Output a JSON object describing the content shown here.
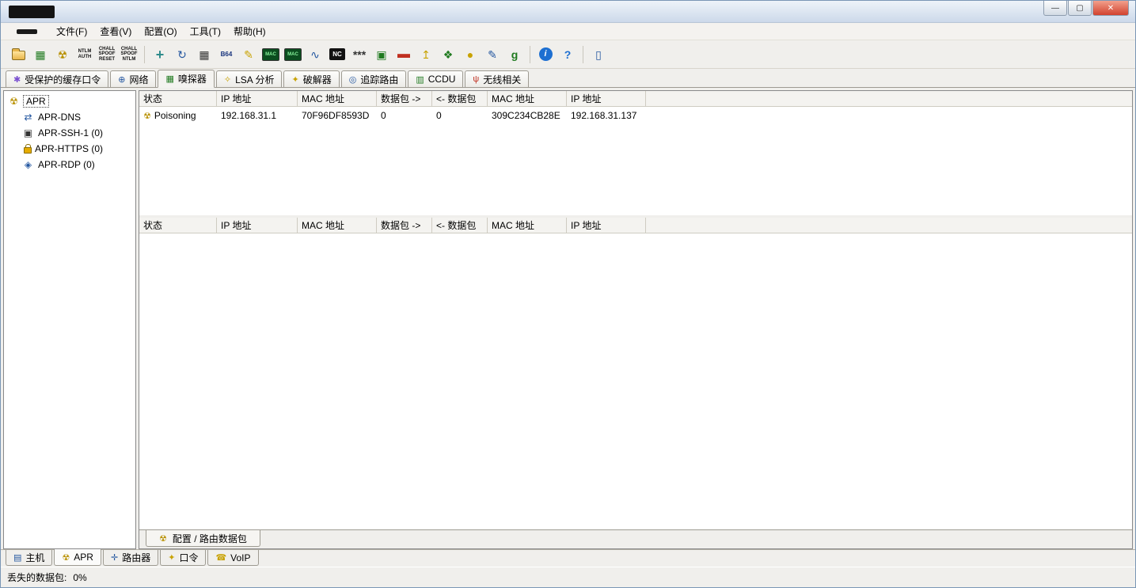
{
  "window": {
    "controls": {
      "minimize": "—",
      "maximize": "▢",
      "close": "✕"
    }
  },
  "menu": {
    "items": [
      {
        "label": "文件(F)"
      },
      {
        "label": "查看(V)"
      },
      {
        "label": "配置(O)"
      },
      {
        "label": "工具(T)"
      },
      {
        "label": "帮助(H)"
      }
    ]
  },
  "toolbar": {
    "icons": [
      {
        "name": "open-file-icon",
        "glyph": ""
      },
      {
        "name": "network-adapter-icon",
        "glyph": "▦"
      },
      {
        "name": "start-stop-apr-icon",
        "glyph": "☢"
      },
      {
        "name": "ntlm-auth-icon",
        "glyph": "NTLM AUTH"
      },
      {
        "name": "chall-spoof-reset-icon",
        "glyph": "CHALL SPOOF RESET"
      },
      {
        "name": "chall-spoof-ntlm-icon",
        "glyph": "CHALL SPOOF NTLM"
      },
      {
        "name": "add-to-list-icon",
        "glyph": "+"
      },
      {
        "name": "restore-icon",
        "glyph": "↻"
      },
      {
        "name": "checkerboard-icon",
        "glyph": "▦"
      },
      {
        "name": "base64-icon",
        "glyph": "B64"
      },
      {
        "name": "notes-icon",
        "glyph": "✎"
      },
      {
        "name": "mac-scanner-icon",
        "glyph": "MAC"
      },
      {
        "name": "mac-monitor-icon",
        "glyph": "MAC"
      },
      {
        "name": "wiretap-icon",
        "glyph": "∿"
      },
      {
        "name": "netcat-icon",
        "glyph": "NC"
      },
      {
        "name": "password-list-icon",
        "glyph": "***"
      },
      {
        "name": "remote-console-icon",
        "glyph": "▣"
      },
      {
        "name": "rdp-screen-icon",
        "glyph": "▬"
      },
      {
        "name": "upload-icon",
        "glyph": "↥"
      },
      {
        "name": "certificates-icon",
        "glyph": "❖"
      },
      {
        "name": "sphere-icon",
        "glyph": "●"
      },
      {
        "name": "edit-page-icon",
        "glyph": "✎"
      },
      {
        "name": "messenger-icon",
        "glyph": "g"
      },
      {
        "name": "info-icon",
        "glyph": "i"
      },
      {
        "name": "help-icon",
        "glyph": "?"
      },
      {
        "name": "exit-icon",
        "glyph": "▯"
      }
    ]
  },
  "tabs_top": {
    "items": [
      {
        "label": "受保护的缓存口令",
        "glyph": "✱"
      },
      {
        "label": "网络",
        "glyph": "⊕"
      },
      {
        "label": "嗅探器",
        "glyph": "▦"
      },
      {
        "label": "LSA 分析",
        "glyph": "✧"
      },
      {
        "label": "破解器",
        "glyph": "✦"
      },
      {
        "label": "追踪路由",
        "glyph": "◎"
      },
      {
        "label": "CCDU",
        "glyph": "▥"
      },
      {
        "label": "无线相关",
        "glyph": "ψ"
      }
    ]
  },
  "tree": {
    "items": [
      {
        "label": "APR",
        "glyph": "☢"
      },
      {
        "label": "APR-DNS",
        "glyph": "⇄"
      },
      {
        "label": "APR-SSH-1 (0)",
        "glyph": "▣"
      },
      {
        "label": "APR-HTTPS (0)",
        "glyph": ""
      },
      {
        "label": "APR-RDP (0)",
        "glyph": "◈"
      }
    ]
  },
  "table": {
    "columns": [
      "状态",
      "IP 地址",
      "MAC 地址",
      "数据包 ->",
      "<- 数据包",
      "MAC 地址",
      "IP 地址"
    ],
    "rows": [
      {
        "icon": "☢",
        "status": "Poisoning",
        "ip_left": "192.168.31.1",
        "mac_left": "70F96DF8593D",
        "packets_to": "0",
        "packets_from": "0",
        "mac_right": "309C234CB28E",
        "ip_right": "192.168.31.137"
      }
    ]
  },
  "lower_table": {
    "columns": [
      "状态",
      "IP 地址",
      "MAC 地址",
      "数据包 ->",
      "<- 数据包",
      "MAC 地址",
      "IP 地址"
    ]
  },
  "content_tab": {
    "label": "配置 / 路由数据包",
    "glyph": "☢"
  },
  "tabs_bottom": {
    "items": [
      {
        "label": "主机",
        "glyph": "▤"
      },
      {
        "label": "APR",
        "glyph": "☢"
      },
      {
        "label": "路由器",
        "glyph": "✛"
      },
      {
        "label": "口令",
        "glyph": "✦"
      },
      {
        "label": "VoIP",
        "glyph": "☎"
      }
    ]
  },
  "statusbar": {
    "label": "丢失的数据包:",
    "value": "0%"
  }
}
